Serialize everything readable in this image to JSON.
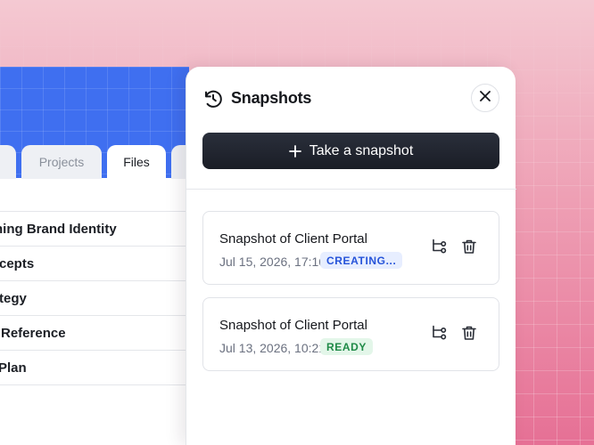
{
  "background": {
    "accent": "#e67095"
  },
  "left_panel": {
    "tabs": [
      {
        "label": "",
        "active": false
      },
      {
        "label": "Projects",
        "active": false
      },
      {
        "label": "Files",
        "active": true
      },
      {
        "label": "",
        "active": false
      }
    ],
    "files": [
      {
        "name": "ning Brand Identity"
      },
      {
        "name": "cepts"
      },
      {
        "name": "tegy"
      },
      {
        "name": "Reference"
      },
      {
        "name": "Plan"
      }
    ],
    "banner_color": "#3f6ff0"
  },
  "drawer": {
    "title": "Snapshots",
    "title_icon": "history-clock-icon",
    "close_icon": "close-icon",
    "take_snapshot_label": "Take a snapshot",
    "take_snapshot_icon": "plus-icon",
    "snapshots": [
      {
        "title": "Snapshot of Client Portal",
        "date": "Jul 15, 2026, 17:16",
        "status": "CREATING...",
        "status_color": "#2553d9",
        "actions": [
          "branch-icon",
          "trash-icon"
        ]
      },
      {
        "title": "Snapshot of Client Portal",
        "date": "Jul 13, 2026, 10:21",
        "status": "READY",
        "status_color": "#1f8a47",
        "actions": [
          "branch-icon",
          "trash-icon"
        ]
      }
    ]
  }
}
